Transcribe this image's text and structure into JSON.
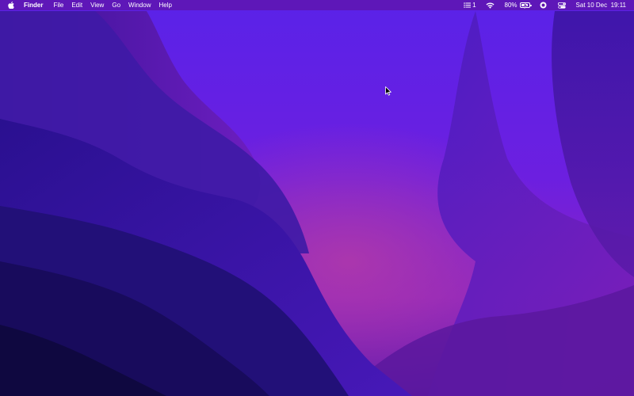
{
  "menubar": {
    "apple_icon": "apple-logo-icon",
    "app_name": "Finder",
    "menus": [
      "File",
      "Edit",
      "View",
      "Go",
      "Window",
      "Help"
    ],
    "status": {
      "list_count": "1",
      "wifi_icon": "wifi-icon",
      "battery_percent": "80%",
      "battery_level": 0.8,
      "screen_record_icon": "record-icon",
      "control_center_icon": "control-center-icon",
      "clock": "Sat 10 Dec  19:11"
    }
  },
  "desktop": {
    "wallpaper": "macOS Monterey purple",
    "colors": {
      "deep": "#160a4a",
      "mid": "#3b16a8",
      "bright": "#6a1fe6",
      "magenta": "#9a2ab8"
    }
  }
}
